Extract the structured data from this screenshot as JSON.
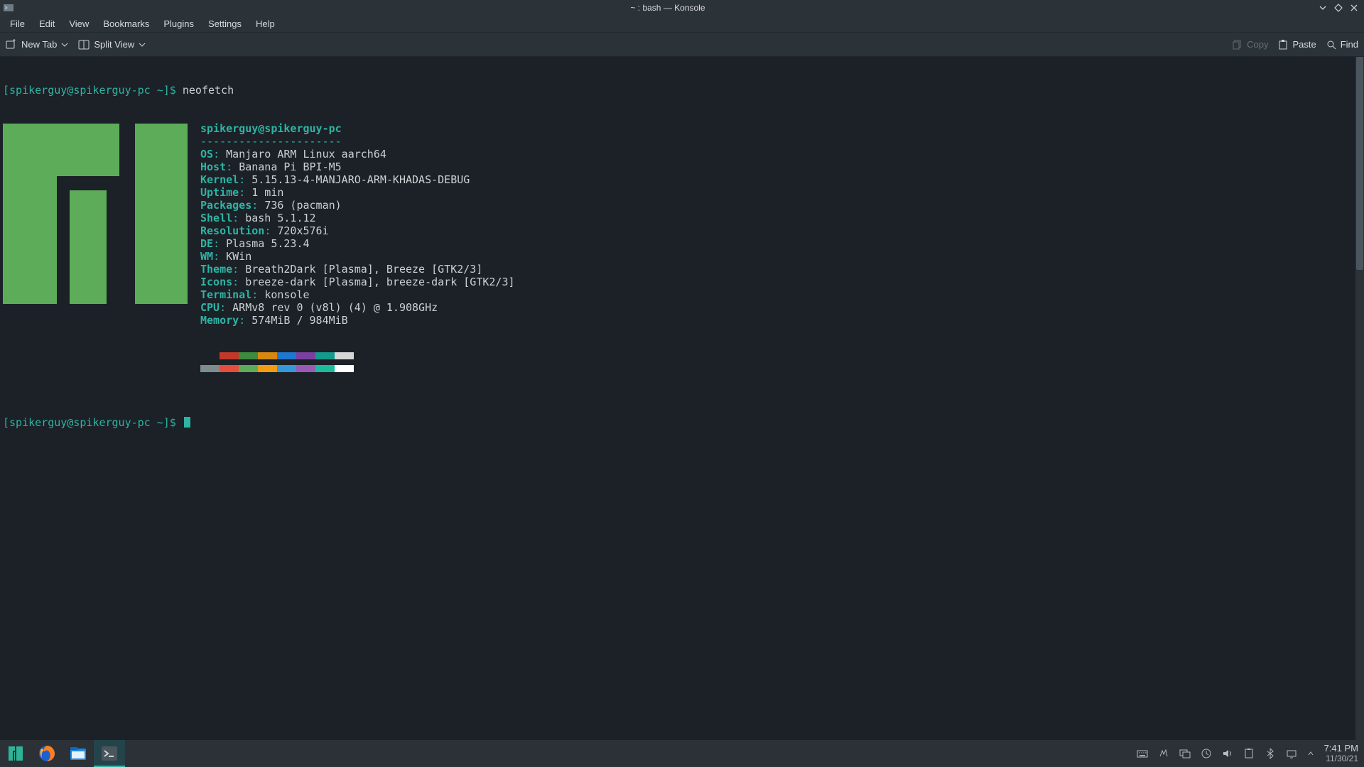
{
  "window": {
    "title": "~ : bash — Konsole"
  },
  "menu": {
    "file": "File",
    "edit": "Edit",
    "view": "View",
    "bookmarks": "Bookmarks",
    "plugins": "Plugins",
    "settings": "Settings",
    "help": "Help"
  },
  "toolbar": {
    "new_tab": "New Tab",
    "split_view": "Split View",
    "copy": "Copy",
    "paste": "Paste",
    "find": "Find"
  },
  "prompt": {
    "user_host": "[spikerguy@spikerguy-pc ~]$",
    "command": "neofetch"
  },
  "fetch": {
    "header": "spikerguy@spikerguy-pc",
    "dashes": "----------------------",
    "rows": [
      {
        "label": "OS",
        "value": "Manjaro ARM Linux aarch64"
      },
      {
        "label": "Host",
        "value": "Banana Pi BPI-M5"
      },
      {
        "label": "Kernel",
        "value": "5.15.13-4-MANJARO-ARM-KHADAS-DEBUG"
      },
      {
        "label": "Uptime",
        "value": "1 min"
      },
      {
        "label": "Packages",
        "value": "736 (pacman)"
      },
      {
        "label": "Shell",
        "value": "bash 5.1.12"
      },
      {
        "label": "Resolution",
        "value": "720x576i"
      },
      {
        "label": "DE",
        "value": "Plasma 5.23.4"
      },
      {
        "label": "WM",
        "value": "KWin"
      },
      {
        "label": "Theme",
        "value": "Breath2Dark [Plasma], Breeze [GTK2/3]"
      },
      {
        "label": "Icons",
        "value": "breeze-dark [Plasma], breeze-dark [GTK2/3]"
      },
      {
        "label": "Terminal",
        "value": "konsole"
      },
      {
        "label": "CPU",
        "value": "ARMv8 rev 0 (v8l) (4) @ 1.908GHz"
      },
      {
        "label": "Memory",
        "value": "574MiB / 984MiB"
      }
    ],
    "colors_dark": [
      "#1b2126",
      "#c0392b",
      "#3d8b3d",
      "#d68910",
      "#1f77d0",
      "#7b3fa0",
      "#159b8d",
      "#d6d6d6"
    ],
    "colors_bright": [
      "#7f8c8d",
      "#e74c3c",
      "#5cac5a",
      "#f39c12",
      "#3498db",
      "#9b59b6",
      "#1abc9c",
      "#ffffff"
    ]
  },
  "clock": {
    "time": "7:41 PM",
    "date": "11/30/21"
  }
}
